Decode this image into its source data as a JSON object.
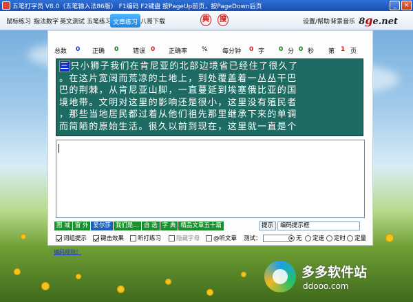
{
  "window": {
    "title": "五笔打字员 V8.0（五笔输入法86版）  F1编码  F2键盘  按PageUp前页，按PageDown后页",
    "minimize": "_",
    "close": "×"
  },
  "menu": {
    "items": [
      "鼠标练习",
      "指法数字",
      "英文测试",
      "五笔练习",
      "文章练习",
      "八哥下载"
    ],
    "active_index": 4,
    "badge_1": "典",
    "badge_2": "搜",
    "settings": "设置/帮助",
    "music": "背景音乐",
    "brand_num": "8",
    "brand_big": "g",
    "brand_rest": "e.net"
  },
  "stats": {
    "total_label": "总数",
    "total_value": "0",
    "correct_label": "正确",
    "correct_value": "0",
    "error_label": "错误",
    "error_value": "0",
    "rate_label": "正确率",
    "rate_unit": "%",
    "speed_label": "每分钟",
    "speed_value": "0",
    "speed_unit": "字",
    "min_value": "0",
    "min_label": "分",
    "sec_value": "0",
    "sec_label": "秒",
    "page_prefix": "第",
    "page_value": "1",
    "page_suffix": "页"
  },
  "article": {
    "first_char": "三",
    "line_1_rest": "只小狮子我们在肯尼亚的北部边境省已经住了很久了",
    "line_2": "。在这片宽阔而荒凉的土地上，到处覆盖着一丛丛干巴",
    "line_3": "巴的荆棘，从肯尼亚山脚，一直蔓延到埃塞俄比亚的国",
    "line_4": "境地带。文明对这里的影响还是很小，这里没有殖民者",
    "line_5": "，那些当地居民都过着从他们祖先那里继承下来的单调",
    "line_6": "而简陋的原始生活。很久以前到现在，这里就一直是个"
  },
  "tags": [
    "图 域",
    "窗 外",
    "爱尔莎",
    "我们是…",
    "自 选",
    "字 典",
    "精品文章五十篇"
  ],
  "tags_selected_index": 2,
  "hint": {
    "label": "提示",
    "value": "编码提示框"
  },
  "options": {
    "cizu": "词组提示",
    "jianji": "键击效果",
    "tingda": "听打练习",
    "moni": "隐藏字母",
    "tingwen": "@听文章",
    "test_label": "测试：",
    "r_none": "无",
    "r_fixed": "定速",
    "r_timed": "定时",
    "r_count": "定量"
  },
  "footer_link": "编码规则！",
  "watermark": {
    "cn": "多多软件站",
    "en": "ddooo.com"
  }
}
